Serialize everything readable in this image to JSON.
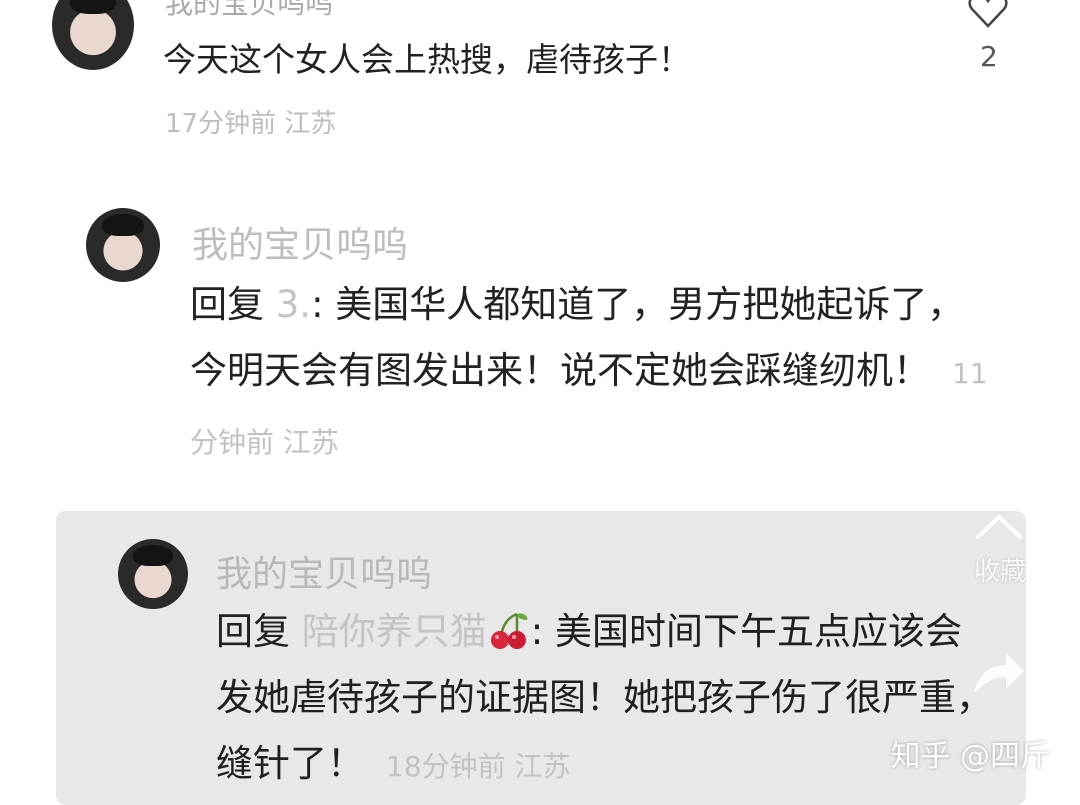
{
  "comments": [
    {
      "username": "我的宝贝呜呜",
      "text": "今天这个女人会上热搜，虐待孩子！",
      "time": "17分钟前",
      "location": "江苏",
      "likes": "2"
    },
    {
      "username": "我的宝贝呜呜",
      "reply_prefix": "回复",
      "reply_target": "3.",
      "text": ": 美国华人都知道了，男方把她起诉了，今明天会有图发出来！说不定她会踩缝纫机！",
      "time": "11分钟前",
      "location": "江苏"
    },
    {
      "username": "我的宝贝呜呜",
      "reply_prefix": "回复",
      "reply_target": "陪你养只猫",
      "text": ": 美国时间下午五点应该会发她虐待孩子的证据图！她把孩子伤了很严重，缝针了！",
      "time": "18分钟前",
      "location": "江苏"
    }
  ],
  "collect_label": "收藏",
  "watermark": "知乎 @四斤",
  "icons": {
    "like": "heart-outline-icon",
    "cherry": "cherry-emoji-icon",
    "collect": "star-icon",
    "share": "share-arrow-icon"
  }
}
